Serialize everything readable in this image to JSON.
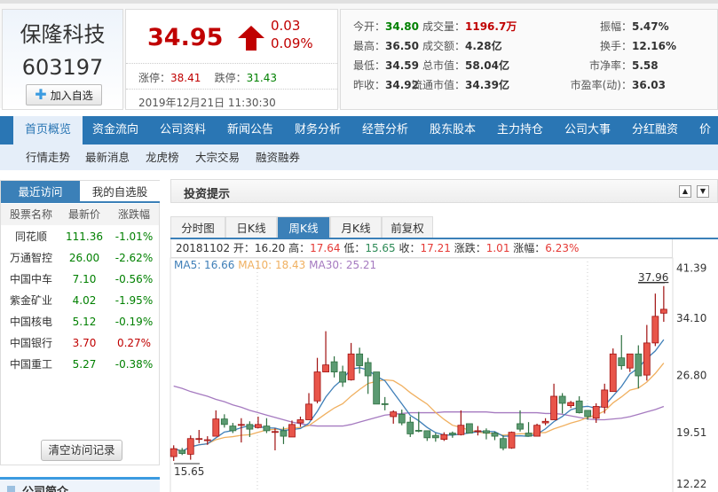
{
  "stock": {
    "name": "保隆科技",
    "code": "603197",
    "add_label": "加入自选",
    "price": "34.95",
    "change": "0.03",
    "change_pct": "0.09%",
    "limit_up_label": "涨停：",
    "limit_up": "38.41",
    "limit_down_label": "跌停：",
    "limit_down": "31.43",
    "datetime": "2019年12月21日 11:30:30"
  },
  "stats": [
    {
      "label": "今开：",
      "value": "34.80",
      "color": "#008000"
    },
    {
      "label": "最高：",
      "value": "36.50"
    },
    {
      "label": "最低：",
      "value": "34.59"
    },
    {
      "label": "昨收：",
      "value": "34.92"
    },
    {
      "label": "成交量：",
      "value": "1196.7万",
      "color": "#c00000"
    },
    {
      "label": "成交额：",
      "value": "4.28亿"
    },
    {
      "label": "总市值：",
      "value": "58.04亿"
    },
    {
      "label": "流通市值：",
      "value": "34.39亿"
    },
    {
      "label": "振幅：",
      "value": "5.47%"
    },
    {
      "label": "换手：",
      "value": "12.16%"
    },
    {
      "label": "市净率：",
      "value": "5.58"
    },
    {
      "label": "市盈率(动)：",
      "value": "36.03"
    }
  ],
  "nav": [
    "首页概览",
    "资金流向",
    "公司资料",
    "新闻公告",
    "财务分析",
    "经营分析",
    "股东股本",
    "主力持仓",
    "公司大事",
    "分红融资",
    "价值"
  ],
  "subnav": [
    "行情走势",
    "最新消息",
    "龙虎榜",
    "大宗交易",
    "融资融券"
  ],
  "left": {
    "tabs": [
      "最近访问",
      "我的自选股"
    ],
    "headers": [
      "股票名称",
      "最新价",
      "涨跌幅"
    ],
    "rows": [
      {
        "name": "同花顺",
        "price": "111.36",
        "pct": "-1.01%",
        "up": false
      },
      {
        "name": "万通智控",
        "price": "26.00",
        "pct": "-2.62%",
        "up": false
      },
      {
        "name": "中国中车",
        "price": "7.10",
        "pct": "-0.56%",
        "up": false
      },
      {
        "name": "紫金矿业",
        "price": "4.02",
        "pct": "-1.95%",
        "up": false
      },
      {
        "name": "中国核电",
        "price": "5.12",
        "pct": "-0.19%",
        "up": false
      },
      {
        "name": "中国银行",
        "price": "3.70",
        "pct": "0.27%",
        "up": true
      },
      {
        "name": "中国重工",
        "price": "5.27",
        "pct": "-0.38%",
        "up": false
      }
    ],
    "clear_label": "清空访问记录",
    "intro_title": "公司简介"
  },
  "tip": {
    "title": "投资提示",
    "up_icon": "▲",
    "down_icon": "▼"
  },
  "ktabs": [
    "分时图",
    "日K线",
    "周K线",
    "月K线",
    "前复权"
  ],
  "ohlc": {
    "date": "20181102",
    "open_label": "开：",
    "open": "16.20",
    "high_label": "高：",
    "high": "17.64",
    "low_label": "低：",
    "low": "15.65",
    "close_label": "收：",
    "close": "17.21",
    "chg_label": "涨跌：",
    "chg": "1.01",
    "pct_label": "涨幅：",
    "pct": "6.23%"
  },
  "ma": {
    "ma5": "MA5: 16.66",
    "ma10": "MA10: 18.43",
    "ma30": "MA30: 25.21"
  },
  "colors": {
    "up": "#e8554a",
    "down": "#5b9a72",
    "ma5": "#3f7fb8",
    "ma10": "#f0b060",
    "ma30": "#a57ac0",
    "nav": "#2a76b4"
  },
  "chart_data": {
    "type": "candlestick",
    "period": "weekly",
    "first_date": "20181102",
    "yticks": [
      41.39,
      34.1,
      26.8,
      19.51,
      12.22
    ],
    "max_label": "37.96",
    "min_label": "15.65",
    "ohlc": [
      [
        16.2,
        17.21,
        17.64,
        15.65
      ],
      [
        17.0,
        16.6,
        17.3,
        16.4
      ],
      [
        16.5,
        18.5,
        18.9,
        15.8
      ],
      [
        18.4,
        18.5,
        19.6,
        17.9
      ],
      [
        18.3,
        18.35,
        18.8,
        17.7
      ],
      [
        18.8,
        21.0,
        22.1,
        18.8
      ],
      [
        21.0,
        20.3,
        21.6,
        19.9
      ],
      [
        20.1,
        19.5,
        20.5,
        19.2
      ],
      [
        20.2,
        20.3,
        21.1,
        18.0
      ],
      [
        20.3,
        19.7,
        20.7,
        18.7
      ],
      [
        19.9,
        20.3,
        21.3,
        19.8
      ],
      [
        20.1,
        19.5,
        21.1,
        19.2
      ],
      [
        19.3,
        19.4,
        19.8,
        17.0
      ],
      [
        19.5,
        18.8,
        20.0,
        17.8
      ],
      [
        18.7,
        20.3,
        20.8,
        18.7
      ],
      [
        20.5,
        20.9,
        21.3,
        20.0
      ],
      [
        20.9,
        22.9,
        24.3,
        20.9
      ],
      [
        23.3,
        27.0,
        28.8,
        23.0
      ],
      [
        27.0,
        27.9,
        32.2,
        27.0
      ],
      [
        28.3,
        27.0,
        29.0,
        26.3
      ],
      [
        27.0,
        25.7,
        27.8,
        25.1
      ],
      [
        26.0,
        29.3,
        30.7,
        25.9
      ],
      [
        29.3,
        27.8,
        30.1,
        26.8
      ],
      [
        28.2,
        26.5,
        28.8,
        24.2
      ],
      [
        27.0,
        22.9,
        27.0,
        22.9
      ],
      [
        22.95,
        22.9,
        23.8,
        22.1
      ],
      [
        21.3,
        21.9,
        22.1,
        20.4
      ],
      [
        21.6,
        20.5,
        22.2,
        20.2
      ],
      [
        20.6,
        19.1,
        21.3,
        18.7
      ],
      [
        19.55,
        19.5,
        21.9,
        19.3
      ],
      [
        19.5,
        18.6,
        19.5,
        18.2
      ],
      [
        18.9,
        18.6,
        19.2,
        18.1
      ],
      [
        18.4,
        19.0,
        19.3,
        18.2
      ],
      [
        19.2,
        19.0,
        19.4,
        18.6
      ],
      [
        19.0,
        20.2,
        22.1,
        18.9
      ],
      [
        20.4,
        19.2,
        20.4,
        19.2
      ],
      [
        19.4,
        19.5,
        20.1,
        18.9
      ],
      [
        19.5,
        19.2,
        19.8,
        18.4
      ],
      [
        19.2,
        18.8,
        19.4,
        18.3
      ],
      [
        18.5,
        17.3,
        18.9,
        17.0
      ],
      [
        17.3,
        19.3,
        19.4,
        17.2
      ],
      [
        20.4,
        19.7,
        22.1,
        19.4
      ],
      [
        19.2,
        18.8,
        20.6,
        18.8
      ],
      [
        18.8,
        20.2,
        20.4,
        18.8
      ],
      [
        20.5,
        20.7,
        21.1,
        20.2
      ],
      [
        20.9,
        23.9,
        25.5,
        20.9
      ],
      [
        23.9,
        23.0,
        24.3,
        21.7
      ],
      [
        22.7,
        23.1,
        23.3,
        22.4
      ],
      [
        23.3,
        21.8,
        23.9,
        21.7
      ],
      [
        22.1,
        21.3,
        22.1,
        20.9
      ],
      [
        21.1,
        22.6,
        23.0,
        20.5
      ],
      [
        22.5,
        24.7,
        25.5,
        21.7
      ],
      [
        24.5,
        29.3,
        30.0,
        24.5
      ],
      [
        28.8,
        27.8,
        31.7,
        27.3
      ],
      [
        27.5,
        29.3,
        29.3,
        27.0
      ],
      [
        29.3,
        26.5,
        30.4,
        24.9
      ],
      [
        26.6,
        30.7,
        33.0,
        25.9
      ],
      [
        30.7,
        34.1,
        37.0,
        30.3
      ],
      [
        34.5,
        35.0,
        37.96,
        33.4
      ]
    ],
    "ma30": [
      25.2,
      24.9,
      24.5,
      24.2,
      23.9,
      23.5,
      23.2,
      22.8,
      22.5,
      22.1,
      21.8,
      21.5,
      21.2,
      20.9,
      20.6,
      20.4,
      20.2,
      20.1,
      20.1,
      20.1,
      20.1,
      20.3,
      20.6,
      20.9,
      21.2,
      21.5,
      21.6,
      21.7,
      21.8,
      21.8,
      21.8,
      21.8,
      21.9,
      21.9,
      21.9,
      21.9,
      21.9,
      21.9,
      21.8,
      21.8,
      21.8,
      21.8,
      21.8,
      21.8,
      21.7,
      21.7,
      21.6,
      21.4,
      21.2,
      21.0,
      20.9,
      20.9,
      21.0,
      21.1,
      21.3,
      21.6,
      21.9,
      22.2,
      22.6
    ]
  }
}
